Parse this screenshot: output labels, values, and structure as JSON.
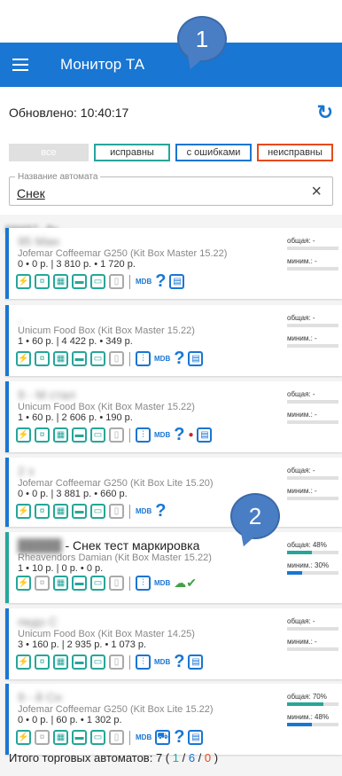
{
  "callouts": [
    "1",
    "2"
  ],
  "appbar": {
    "title": "Монитор ТА"
  },
  "status": {
    "updated": "Обновлено: 10:40:17"
  },
  "filters": {
    "all": "все",
    "ok": "исправны",
    "errors": "с ошибками",
    "faulty": "неисправны"
  },
  "search": {
    "legend": "Название автомата",
    "value": "Снек"
  },
  "group": {
    "label": "586657 - Ру..."
  },
  "labels": {
    "total": "общая:",
    "min": "миним.:",
    "mdb": "MDB",
    "question": "?"
  },
  "cards": [
    {
      "title": "95        Ман",
      "model": "Jofemar Coffeemar G250 (Kit Box Master 15.22)",
      "stats": "0 • 0 р.  | 3 810 р. • 1 720 р.",
      "total": "-",
      "min": "-",
      "total_pct": 0,
      "min_pct": 0
    },
    {
      "title": "                    ,",
      "model": "Unicum Food Box (Kit Box Master 15.22)",
      "stats": "1 • 60 р.  | 4 422 р. • 349 р.",
      "total": "-",
      "min": "-",
      "total_pct": 0,
      "min_pct": 0
    },
    {
      "title": "9         - М         стал",
      "model": "Unicum Food Box (Kit Box Master 15.22)",
      "stats": "1 • 60 р.  | 2 606 р. • 190 р.",
      "total": "-",
      "min": "-",
      "total_pct": 0,
      "min_pct": 0
    },
    {
      "title": "           2          з",
      "model": "Jofemar Coffeemar G250 (Kit Box Lite 15.20)",
      "stats": "0 • 0 р.  | 3 881 р. • 660 р.",
      "total": "-",
      "min": "-",
      "total_pct": 0,
      "min_pct": 0
    },
    {
      "title": "- Снек тест маркировка",
      "model": "Rheavendors Damian (Kit Box Master 15.22)",
      "stats": "1 • 10 р.  | 0 р. • 0 р.",
      "total": "48%",
      "min": "30%",
      "total_pct": 48,
      "min_pct": 30
    },
    {
      "title": "            педо С",
      "model": "Unicum Food Box (Kit Box Master 14.25)",
      "stats": "3 • 160 р.  | 2 935 р. • 1 073 р.",
      "total": "-",
      "min": "-",
      "total_pct": 0,
      "min_pct": 0
    },
    {
      "title": "       9 -         й Сн",
      "model": "Jofemar Coffeemar G250 (Kit Box Lite 15.22)",
      "stats": "0 • 0 р.  | 60 р. • 1 302 р.",
      "total": "70%",
      "min": "48%",
      "total_pct": 70,
      "min_pct": 48
    }
  ],
  "footer": {
    "label": "Итого торговых автоматов:",
    "count": "7",
    "ok": "1",
    "errors": "6",
    "faulty": "0"
  },
  "colors": {
    "primary": "#1976d2",
    "ok": "#26a69a",
    "faulty": "#e64a19"
  }
}
